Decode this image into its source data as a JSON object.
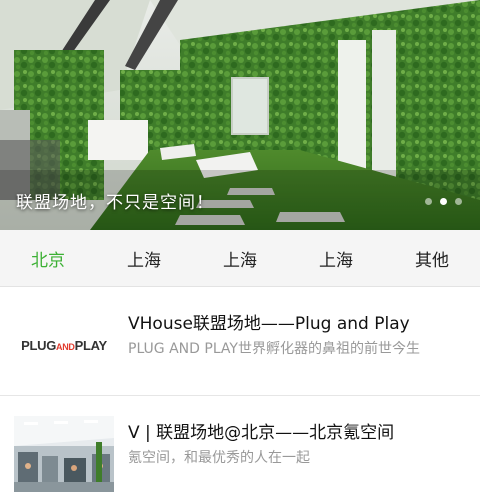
{
  "banner": {
    "caption": "联盟场地，不只是空间！",
    "dot_count": 3,
    "active_dot": 2
  },
  "tabs": [
    {
      "label": "北京",
      "active": true
    },
    {
      "label": "上海",
      "active": false
    },
    {
      "label": "上海",
      "active": false
    },
    {
      "label": "上海",
      "active": false
    },
    {
      "label": "其他",
      "active": false
    }
  ],
  "items": [
    {
      "title": "VHouse联盟场地——Plug and Play",
      "desc": "PLUG AND PLAY世界孵化器的鼻祖的前世今生",
      "thumb": "plug-and-play-logo"
    },
    {
      "title": "V | 联盟场地@北京——北京氪空间",
      "desc": "氪空间，和最优秀的人在一起",
      "thumb": "office-photo"
    }
  ],
  "logo": {
    "part1": "PLUG",
    "part2": "AND",
    "part3": "PLAY"
  },
  "colors": {
    "accent": "#3cb034",
    "tab_bg": "#f5f5f5",
    "muted": "#999999"
  }
}
